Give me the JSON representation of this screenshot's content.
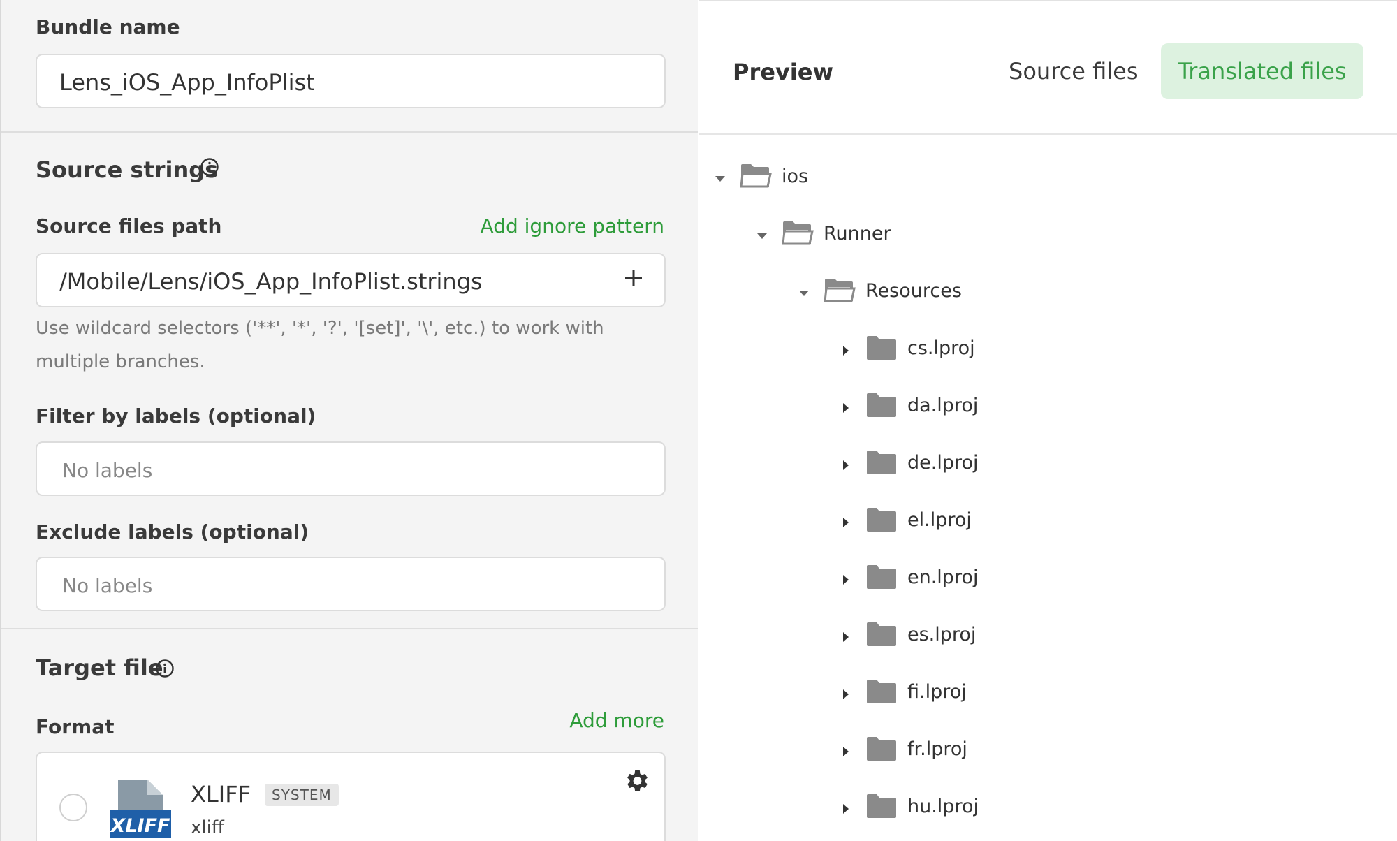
{
  "left": {
    "bundle_label": "Bundle name",
    "bundle_value": "Lens_iOS_App_InfoPlist",
    "source_strings_heading": "Source strings",
    "source_path_label": "Source files path",
    "add_ignore_label": "Add ignore pattern",
    "source_path_value": "/Mobile/Lens/iOS_App_InfoPlist.strings",
    "help_text": "Use wildcard selectors ('**', '*', '?', '[set]', '\\', etc.) to work with multiple branches.",
    "filter_label": "Filter by labels (optional)",
    "filter_placeholder": "No labels",
    "exclude_label": "Exclude labels (optional)",
    "exclude_placeholder": "No labels",
    "target_heading": "Target file",
    "format_label": "Format",
    "add_more_label": "Add more",
    "format_card": {
      "name": "XLIFF",
      "badge": "SYSTEM",
      "extension": "xliff",
      "logo_text": "XLIFF"
    }
  },
  "right": {
    "preview_title": "Preview",
    "tabs": [
      "Source files",
      "Translated files"
    ],
    "active_tab": "Translated files",
    "tree": [
      {
        "name": "ios",
        "level": 0,
        "expanded": true
      },
      {
        "name": "Runner",
        "level": 1,
        "expanded": true
      },
      {
        "name": "Resources",
        "level": 2,
        "expanded": true
      },
      {
        "name": "cs.lproj",
        "level": 3,
        "expanded": false
      },
      {
        "name": "da.lproj",
        "level": 3,
        "expanded": false
      },
      {
        "name": "de.lproj",
        "level": 3,
        "expanded": false
      },
      {
        "name": "el.lproj",
        "level": 3,
        "expanded": false
      },
      {
        "name": "en.lproj",
        "level": 3,
        "expanded": false
      },
      {
        "name": "es.lproj",
        "level": 3,
        "expanded": false
      },
      {
        "name": "fi.lproj",
        "level": 3,
        "expanded": false
      },
      {
        "name": "fr.lproj",
        "level": 3,
        "expanded": false
      },
      {
        "name": "hu.lproj",
        "level": 3,
        "expanded": false
      }
    ]
  },
  "colors": {
    "accent_green": "#2e9c3a",
    "active_tab_bg": "#ddf2e0",
    "folder_gray": "#8a8a8a"
  },
  "icons": [
    "info-icon",
    "plus-icon",
    "gear-icon",
    "folder-open-icon",
    "folder-icon",
    "caret-down-icon",
    "caret-right-icon",
    "xliff-file-icon"
  ]
}
